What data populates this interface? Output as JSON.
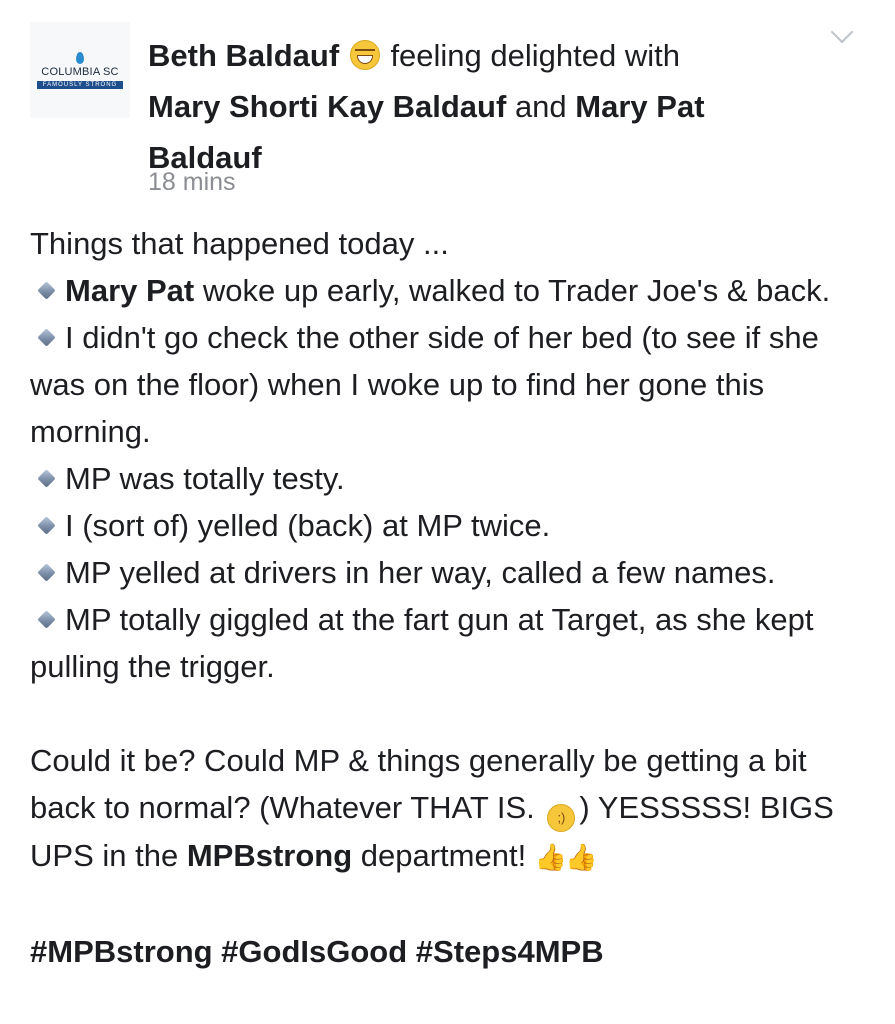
{
  "avatar": {
    "city": "COLUMBIA SC",
    "tagline": "FAMOUSLY STRONG"
  },
  "header": {
    "author": "Beth Baldauf",
    "feeling": "feeling delighted with",
    "tagged1": "Mary Shorti Kay Baldauf",
    "connector": "and",
    "tagged2": "Mary Pat Baldauf",
    "time": "18 mins"
  },
  "post": {
    "intro": "Things that happened today ...",
    "item1_bold": "Mary Pat",
    "item1_rest": " woke up early, walked to Trader Joe's & back.",
    "item2": "I didn't go check the other side of her bed (to see if she was on the floor) when I woke up to find her gone this morning.",
    "item3": "MP was totally testy.",
    "item4": "I (sort of) yelled (back) at MP twice.",
    "item5": "MP yelled at drivers in her way, called a few names.",
    "item6": "MP totally giggled at the fart gun at Target, as she kept pulling the trigger.",
    "para_a": "Could it be? Could MP & things generally be getting a bit back to normal? (Whatever THAT IS. ",
    "para_b": ") YESSSSS! BIGS UPS in the ",
    "para_bold": "MPBstrong",
    "para_c": " department! ",
    "thumbs": "👍👍",
    "hashtags": "#MPBstrong #GodIsGood #Steps4MPB"
  }
}
